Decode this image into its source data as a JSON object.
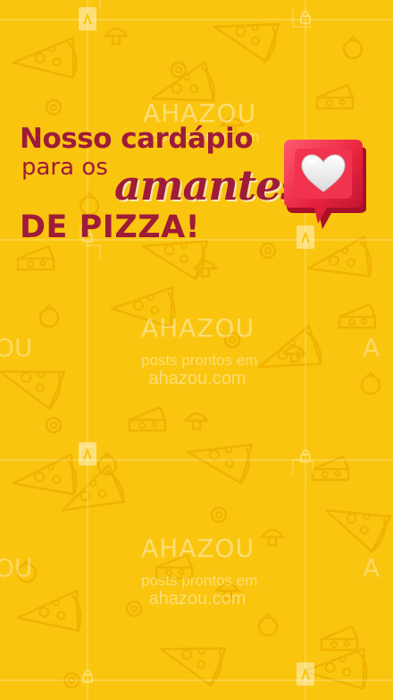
{
  "headline": {
    "line1": "Nosso cardápio",
    "line2": "para os",
    "line3": "amantes",
    "line4": "DE PIZZA!"
  },
  "watermark": {
    "brand": "AHAZOU",
    "line1": "posts prontos em",
    "line2": "ahazou.com",
    "side": "OU"
  },
  "colors": {
    "background": "#FAC50F",
    "pattern": "#F0B400",
    "text": "#9E1B3A",
    "bubble": "#E8233F",
    "heart": "#F7F7F7",
    "watermark": "rgba(255,255,255,0.42)"
  },
  "icons": [
    "pizza-slice-icon",
    "cheese-icon",
    "mushroom-icon",
    "olive-icon",
    "tomato-icon",
    "heart-notification-icon",
    "lock-icon"
  ]
}
